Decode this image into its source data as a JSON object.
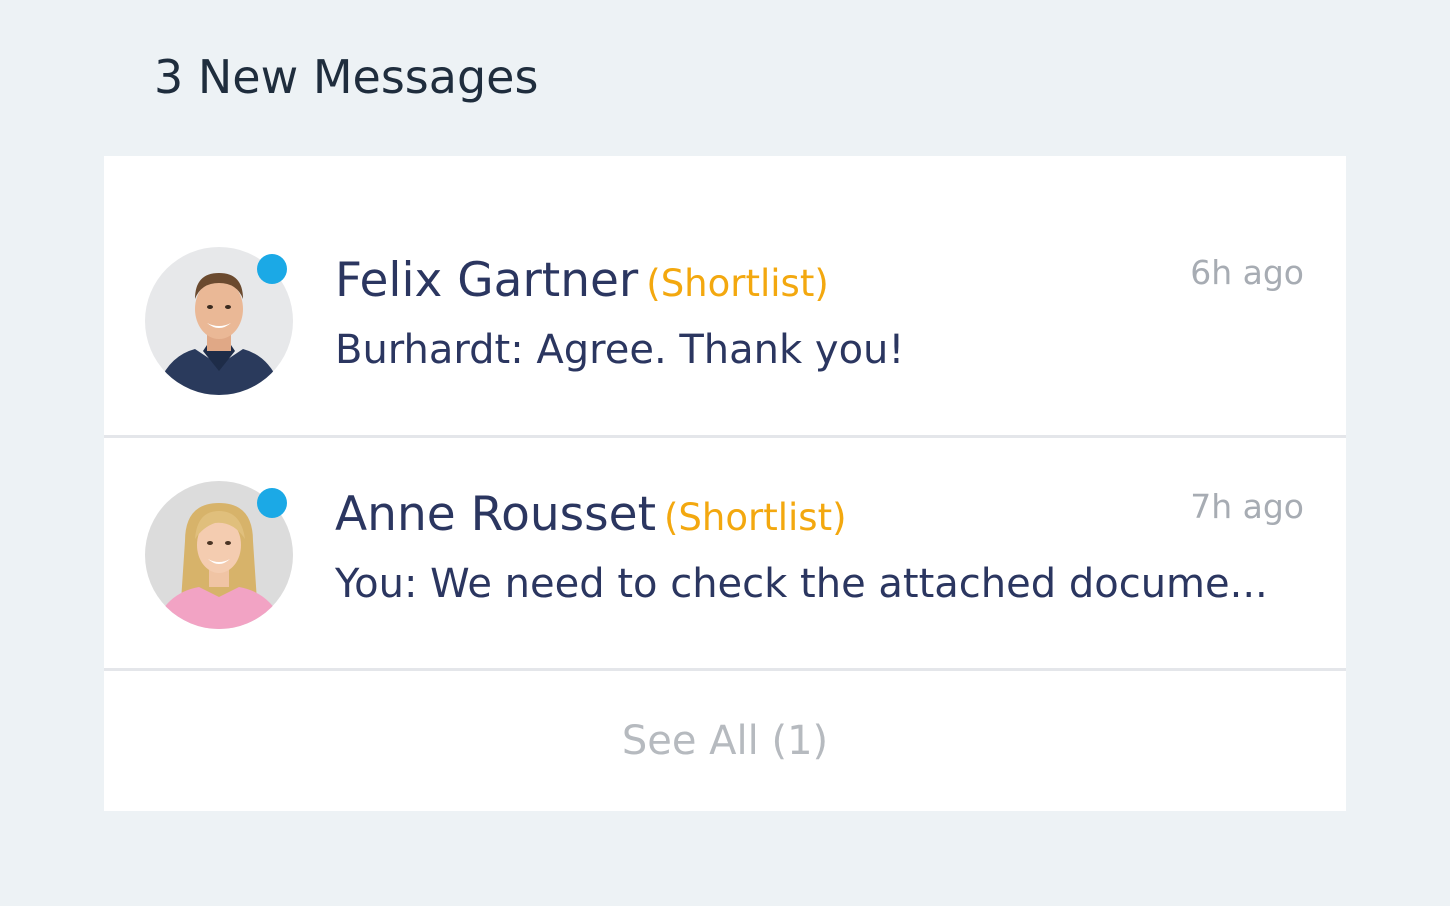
{
  "header": {
    "title": "3 New Messages"
  },
  "messages": [
    {
      "name": "Felix Gartner",
      "tag": "(Shortlist)",
      "time": "6h ago",
      "preview": "Burhardt: Agree. Thank you!",
      "unread": true
    },
    {
      "name": "Anne Rousset",
      "tag": "(Shortlist)",
      "time": "7h ago",
      "preview": "You: We need to check the attached docume...",
      "unread": true
    }
  ],
  "footer": {
    "see_all_label": "See All (1)"
  },
  "colors": {
    "background": "#edf2f5",
    "panel": "#ffffff",
    "name_text": "#2b3660",
    "tag_text": "#f3a80f",
    "timestamp_text": "#a7acb3",
    "online_dot": "#1ba9e6",
    "see_all_text": "#b6babf"
  },
  "icons": {
    "unread": "online-dot-icon"
  }
}
